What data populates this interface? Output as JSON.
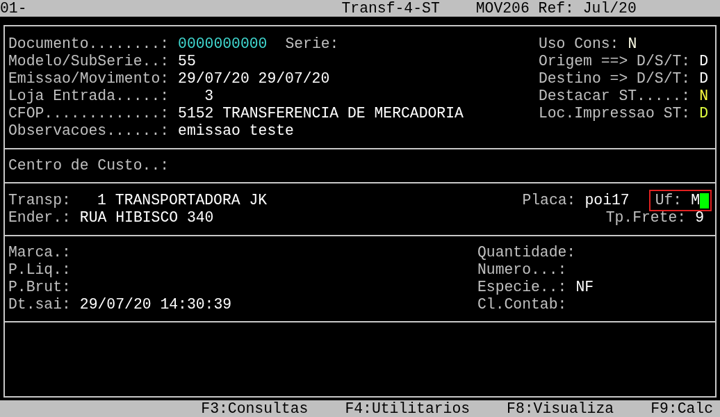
{
  "top_bar": {
    "left": "01-",
    "title": "Transf-4-ST",
    "ref": "MOV206 Ref: Jul/20"
  },
  "document": {
    "left": [
      {
        "label": "Documento........:",
        "value": "0000000000",
        "color": "#40d8d0",
        "extra": "Serie:"
      },
      {
        "label": "Modelo/SubSerie..:",
        "value": "55",
        "color": "#ffffff"
      },
      {
        "label": "Emissao/Movimento:",
        "value": "29/07/20 29/07/20",
        "color": "#ffffff"
      },
      {
        "label": "Loja Entrada.....:",
        "value": "3",
        "color": "#ffffff"
      },
      {
        "label": "CFOP.............:",
        "value": "5152 TRANSFERENCIA DE MERCADORIA",
        "color": "#ffffff"
      },
      {
        "label": "Observacoes......:",
        "value": "emissao teste",
        "color": "#ffffff"
      }
    ],
    "right": [
      {
        "label": "Uso Cons:",
        "value": "N",
        "color": "#ffffe8"
      },
      {
        "label": "Origem ==> D/S/T:",
        "value": "D",
        "color": "#ffffff"
      },
      {
        "label": "Destino => D/S/T:",
        "value": "D",
        "color": "#ffffff"
      },
      {
        "label": "Destacar ST.....:",
        "value": "N",
        "color": "#ffff40"
      },
      {
        "label": "Loc.Impressao ST:",
        "value": "D",
        "color": "#e0ff40"
      }
    ]
  },
  "cost_center": {
    "label": "Centro de Custo..:"
  },
  "carrier": {
    "transp_label": "Transp:",
    "transp_code": "1",
    "transp_name": "TRANSPORTADORA JK",
    "placa_label": "Placa:",
    "placa_value": "poi17",
    "uf_label": "Uf:",
    "uf_value": "M",
    "uf_focused": true,
    "ender_label": "Ender.:",
    "ender_value": "RUA HIBISCO 340",
    "frete_label": "Tp.Frete:",
    "frete_value": "9"
  },
  "volumes": {
    "left": [
      {
        "label": "Marca.:"
      },
      {
        "label": "P.Liq.:"
      },
      {
        "label": "P.Brut:"
      },
      {
        "label": "Dt.sai:",
        "value": "29/07/20 14:30:39"
      }
    ],
    "right": [
      {
        "label": "Quantidade:"
      },
      {
        "label": "Numero...:"
      },
      {
        "label": "Especie..:",
        "value": "NF"
      },
      {
        "label": "Cl.Contab:"
      }
    ]
  },
  "function_keys": [
    "F3:Consultas",
    "F4:Utilitarios",
    "F8:Visualiza",
    "F9:Calc"
  ]
}
